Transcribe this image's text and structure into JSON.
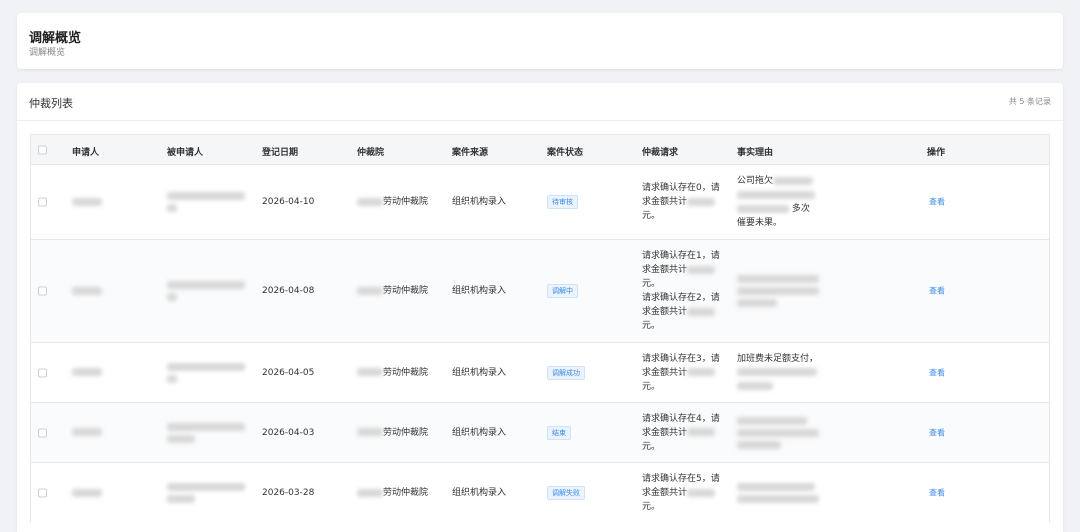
{
  "header": {
    "title": "调解概览",
    "subtitle": "调解概览"
  },
  "list": {
    "title": "仲裁列表",
    "count_text": "共 5 条记录",
    "columns": [
      "申请人",
      "被申请人",
      "登记日期",
      "仲裁院",
      "案件来源",
      "案件状态",
      "仲裁请求",
      "事实理由",
      "操作"
    ],
    "rows": [
      {
        "date": "2026-04-10",
        "court_suffix": "劳动仲裁院",
        "source": "组织机构录入",
        "status": "待审核",
        "request_lines": [
          "请求确认存在0，请",
          "求金额共计",
          "元。"
        ],
        "fact_prefix": "公司拖欠",
        "fact_mid": "多次",
        "fact_end": "催要未果。",
        "action": "查看"
      },
      {
        "date": "2026-04-08",
        "court_suffix": "劳动仲裁院",
        "source": "组织机构录入",
        "status": "调解中",
        "request_lines": [
          "请求确认存在1，请",
          "求金额共计",
          "元。",
          "请求确认存在2，请",
          "求金额共计",
          "元。"
        ],
        "action": "查看"
      },
      {
        "date": "2026-04-05",
        "court_suffix": "劳动仲裁院",
        "source": "组织机构录入",
        "status": "调解成功",
        "request_lines": [
          "请求确认存在3，请",
          "求金额共计",
          "元。"
        ],
        "fact_prefix": "加班费未足额支付，",
        "action": "查看"
      },
      {
        "date": "2026-04-03",
        "court_suffix": "劳动仲裁院",
        "source": "组织机构录入",
        "status": "结束",
        "request_lines": [
          "请求确认存在4，请",
          "求金额共计",
          "元。"
        ],
        "action": "查看"
      },
      {
        "date": "2026-03-28",
        "court_suffix": "劳动仲裁院",
        "source": "组织机构录入",
        "status": "调解失败",
        "request_lines": [
          "请求确认存在5，请",
          "求金额共计",
          "元。"
        ],
        "action": "查看"
      }
    ]
  }
}
